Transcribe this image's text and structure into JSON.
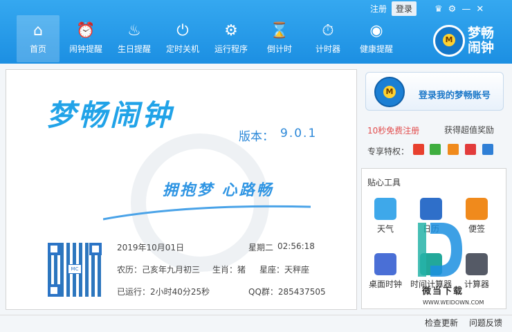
{
  "nav": [
    {
      "label": "首页",
      "icon": "home-icon",
      "glyph": "⌂"
    },
    {
      "label": "闹钟提醒",
      "icon": "alarm-clock-icon",
      "glyph": "⏰"
    },
    {
      "label": "生日提醒",
      "icon": "birthday-cake-icon",
      "glyph": "♨"
    },
    {
      "label": "定时关机",
      "icon": "power-icon",
      "glyph": "⏻"
    },
    {
      "label": "运行程序",
      "icon": "gear-icon",
      "glyph": "⚙"
    },
    {
      "label": "倒计时",
      "icon": "hourglass-icon",
      "glyph": "⌛"
    },
    {
      "label": "计时器",
      "icon": "stopwatch-icon",
      "glyph": "⏱"
    },
    {
      "label": "健康提醒",
      "icon": "eye-icon",
      "glyph": "◉"
    }
  ],
  "header": {
    "register": "注册",
    "login": "登录",
    "logo_line1": "梦畅",
    "logo_line2": "闹钟",
    "logo_badge": "M"
  },
  "main": {
    "title": "梦畅闹钟",
    "version_label": "版本：",
    "version": "9.0.1",
    "slogan": "拥抱梦 心路畅",
    "qr_center": "MC",
    "date": "2019年10月01日",
    "weekday": "星期二",
    "time": "02:56:18",
    "lunar": "农历：己亥年九月初三",
    "zodiac": "生肖：猪",
    "constellation": "星座：天秤座",
    "runtime": "已运行：2小时40分25秒",
    "qq_group": "QQ群：285437505"
  },
  "side": {
    "login_account": "登录我的梦畅账号",
    "login_badge": "M",
    "register_free": "10秒免费注册",
    "reward": "获得超值奖励",
    "privilege_label": "专享特权：",
    "privilege_colors": [
      "#e8402e",
      "#3fae3f",
      "#f08a1c",
      "#e23b3b",
      "#2f7fd6"
    ],
    "tools_title": "贴心工具",
    "tools": [
      {
        "label": "天气",
        "icon": "weather-icon",
        "color": "#3ea8ea"
      },
      {
        "label": "日历",
        "icon": "calendar-icon",
        "color": "#2f6fc9"
      },
      {
        "label": "便签",
        "icon": "note-icon",
        "color": "#f08a1c"
      },
      {
        "label": "桌面时钟",
        "icon": "desktop-clock-icon",
        "color": "#4a6fd6"
      },
      {
        "label": "时间计算器",
        "icon": "time-calculator-icon",
        "color": "#22a89a"
      },
      {
        "label": "计算器",
        "icon": "calculator-icon",
        "color": "#555a66"
      }
    ],
    "watermark_text": "微当下载",
    "watermark_url": "WWW.WEIDOWN.COM"
  },
  "footer": {
    "update": "检查更新",
    "feedback": "问题反馈"
  }
}
